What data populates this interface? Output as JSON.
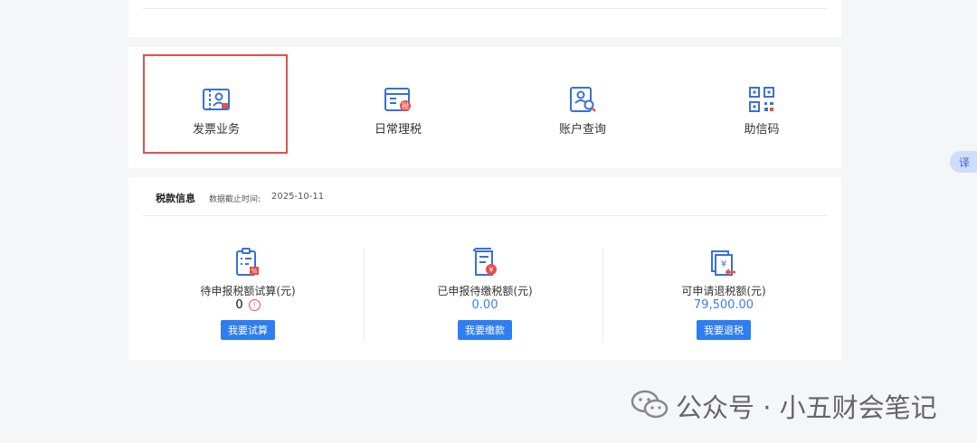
{
  "services": [
    {
      "label": "发票业务",
      "icon": "invoice-icon"
    },
    {
      "label": "日常理税",
      "icon": "daily-tax-icon"
    },
    {
      "label": "账户查询",
      "icon": "account-query-icon"
    },
    {
      "label": "助信码",
      "icon": "qr-code-icon"
    }
  ],
  "tax_info": {
    "title": "税款信息",
    "date_label": "数据截止时间:",
    "date": "2025-10-11",
    "items": [
      {
        "title": "待申报税额试算(元)",
        "amount": "0",
        "button": "我要试算",
        "warn_icon": "!"
      },
      {
        "title": "已申报待缴税额(元)",
        "amount": "0.00",
        "button": "我要缴款"
      },
      {
        "title": "可申请退税额(元)",
        "amount": "79,500.00",
        "button": "我要退税"
      }
    ]
  },
  "translate_tab": {
    "label": "译"
  },
  "watermark": {
    "text": "公众号 · 小五财会笔记"
  },
  "colors": {
    "accent": "#2f7df2",
    "highlight": "#e5504a",
    "amount_blue": "#3a7fe8"
  }
}
